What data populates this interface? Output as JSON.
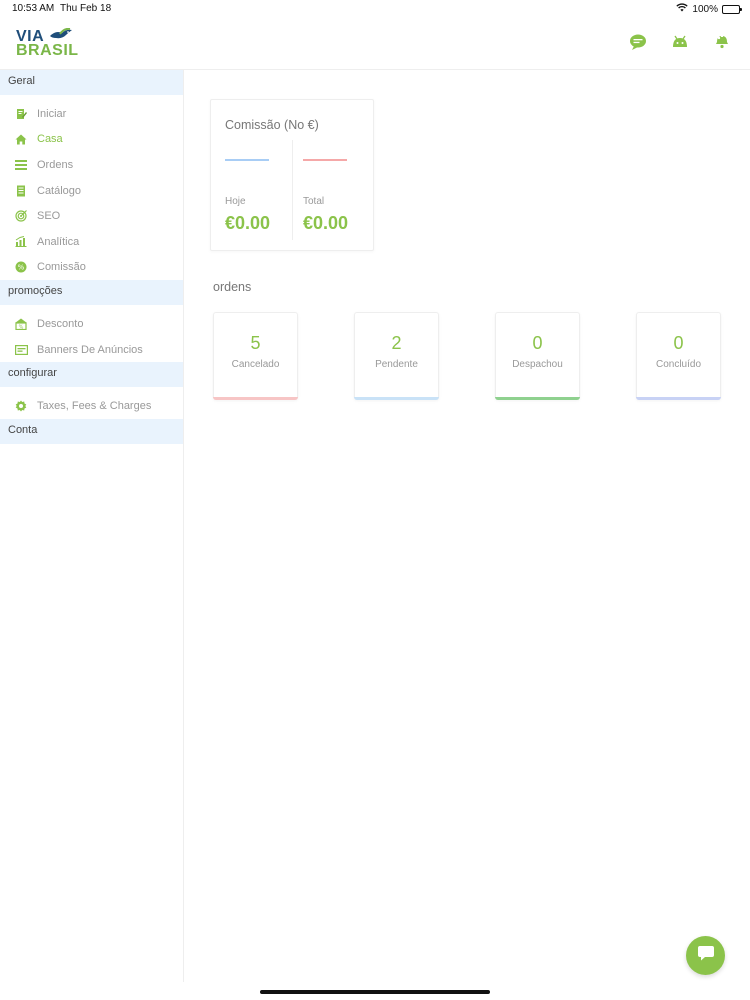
{
  "status_bar": {
    "time": "10:53 AM",
    "date": "Thu Feb 18",
    "battery": "100%"
  },
  "header": {
    "logo_line1": "VIA",
    "logo_line2": "BRASIL",
    "icons": [
      "chat-bubbles-icon",
      "android-icon",
      "notification-bell-icon"
    ]
  },
  "sidebar": {
    "sections": [
      {
        "title": "Geral",
        "items": [
          {
            "label": "Iniciar",
            "icon": "document-edit-icon",
            "active": false
          },
          {
            "label": "Casa",
            "icon": "home-icon",
            "active": true
          },
          {
            "label": "Ordens",
            "icon": "list-icon",
            "active": false
          },
          {
            "label": "Catálogo",
            "icon": "book-icon",
            "active": false
          },
          {
            "label": "SEO",
            "icon": "target-icon",
            "active": false
          },
          {
            "label": "Analítica",
            "icon": "bar-chart-icon",
            "active": false
          },
          {
            "label": "Comissão",
            "icon": "percent-icon",
            "active": false
          }
        ]
      },
      {
        "title": "promoções",
        "items": [
          {
            "label": "Desconto",
            "icon": "discount-icon",
            "active": false
          },
          {
            "label": "Banners De Anúncios",
            "icon": "banner-icon",
            "active": false
          }
        ]
      },
      {
        "title": "configurar",
        "items": [
          {
            "label": "Taxes, Fees & Charges",
            "icon": "settings-gear-icon",
            "active": false
          }
        ]
      },
      {
        "title": "Conta",
        "items": []
      }
    ]
  },
  "commission": {
    "title": "Comissão (No €)",
    "today_label": "Hoje",
    "today_value": "€0.00",
    "total_label": "Total",
    "total_value": "€0.00",
    "today_color": "#a8cdf5",
    "total_color": "#f5a8a8"
  },
  "orders": {
    "title": "ordens",
    "cards": [
      {
        "count": "5",
        "label": "Cancelado",
        "color": "#f7c5c5"
      },
      {
        "count": "2",
        "label": "Pendente",
        "color": "#c9e2f7"
      },
      {
        "count": "0",
        "label": "Despachou",
        "color": "#8fd18f"
      },
      {
        "count": "0",
        "label": "Concluído",
        "color": "#c8d2f5"
      }
    ]
  },
  "colors": {
    "accent": "#8bc34a",
    "section_bg": "#e9f3fd"
  }
}
